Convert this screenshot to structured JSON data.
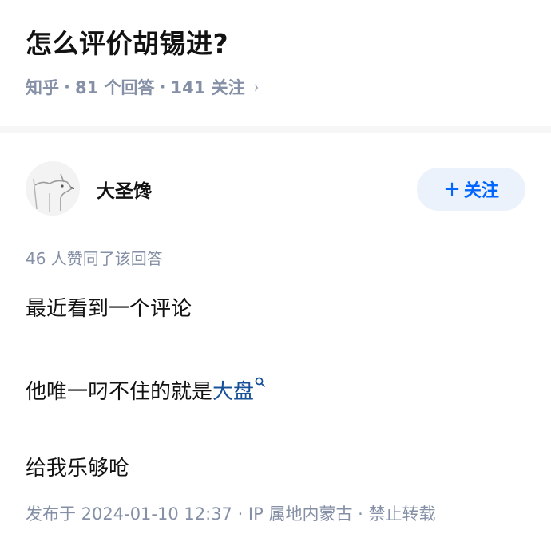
{
  "question": {
    "title": "怎么评价胡锡进?",
    "source": "知乎",
    "answer_count": "81 个回答",
    "follower_count": "141 关注",
    "separator": "·",
    "chevron": "›"
  },
  "author": {
    "name": "大圣馋",
    "avatar_icon": "dog-sketch-avatar-icon"
  },
  "follow_button": {
    "plus": "+",
    "label": "关注"
  },
  "answer": {
    "vote_text": "46 人赞同了该回答",
    "para1": "最近看到一个评论",
    "para2_prefix": "他唯一叼不住的就是",
    "para2_link": "大盘",
    "para3": "给我乐够呛",
    "meta": "发布于 2024-01-10 12:37 · IP 属地内蒙古 · 禁止转载"
  },
  "colors": {
    "link": "#175199",
    "follow_text": "#0066ff",
    "follow_bg": "#ebf2fb",
    "meta_gray": "#8590a6"
  }
}
